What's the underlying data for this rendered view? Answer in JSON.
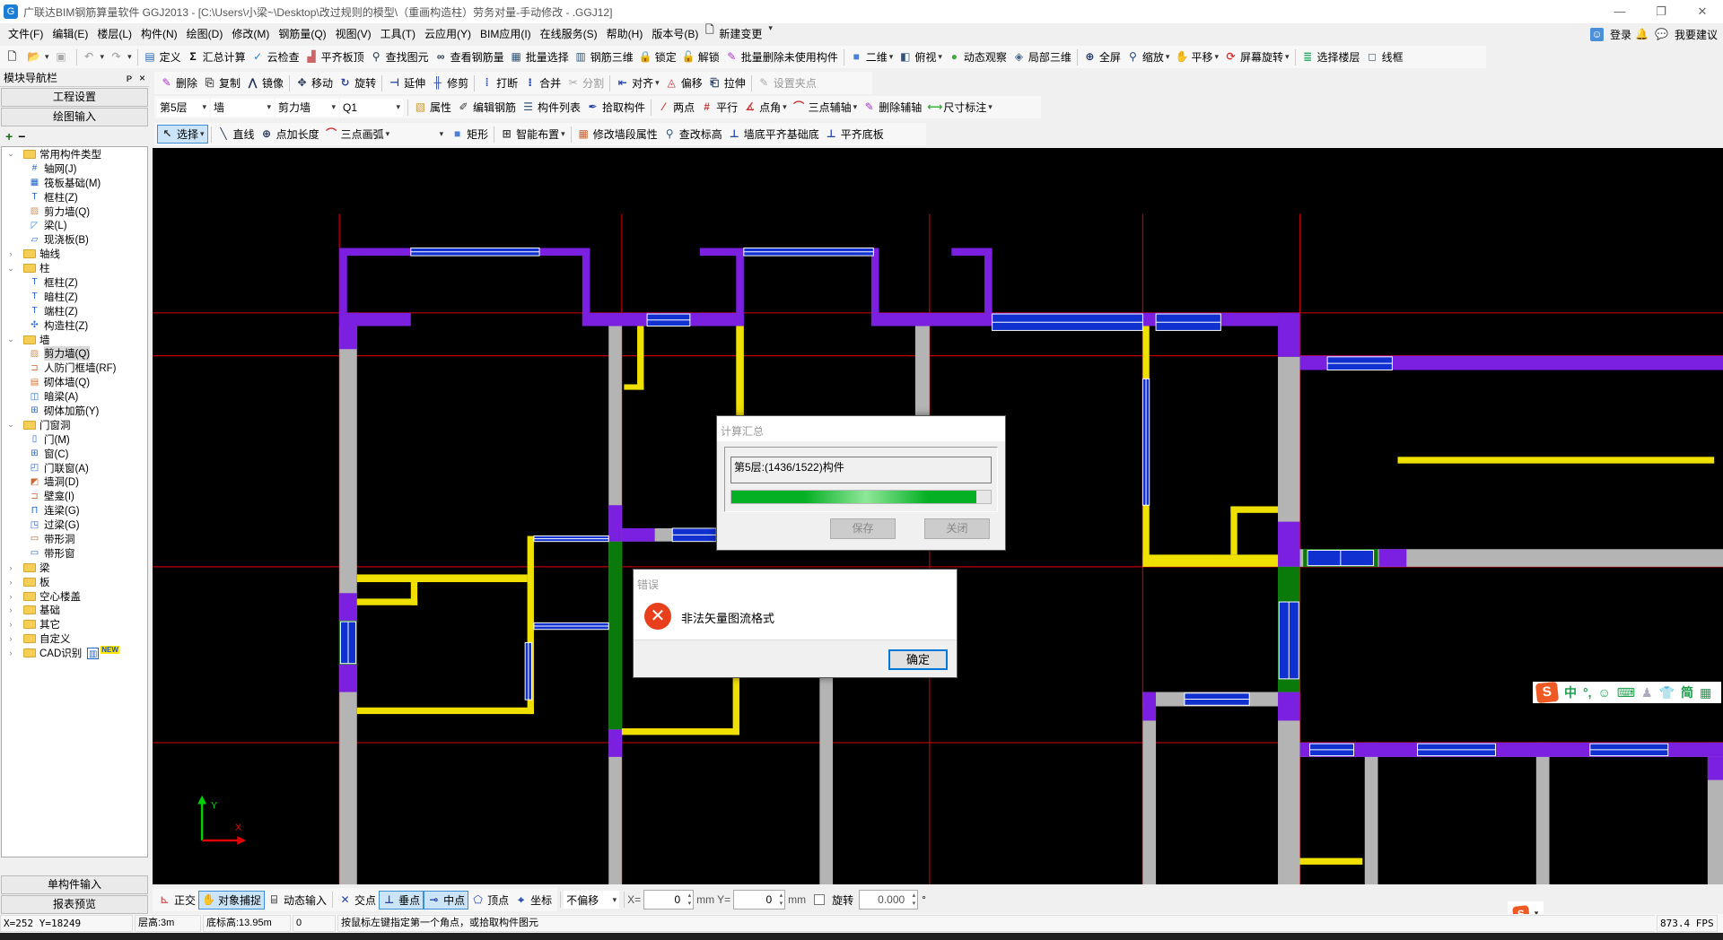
{
  "window": {
    "title": "广联达BIM钢筋算量软件 GGJ2013 - [C:\\Users\\小梁~\\Desktop\\改过规则的模型\\（重画构造柱）劳务对量-手动修改 - .GGJ12]",
    "minimize": "—",
    "restore": "❐",
    "close": "✕"
  },
  "menu": {
    "items": [
      "文件(F)",
      "编辑(E)",
      "楼层(L)",
      "构件(N)",
      "绘图(D)",
      "修改(M)",
      "钢筋量(Q)",
      "视图(V)",
      "工具(T)",
      "云应用(Y)",
      "BIM应用(I)",
      "在线服务(S)",
      "帮助(H)",
      "版本号(B)",
      "新建变更"
    ],
    "login": "登录",
    "suggest": "我要建议"
  },
  "toolbar1": [
    {
      "icon": "new-file",
      "label": ""
    },
    {
      "icon": "open-folder",
      "label": "",
      "dd": true
    },
    {
      "icon": "save",
      "label": "",
      "disabled": true
    },
    {
      "sep": true
    },
    {
      "icon": "undo",
      "label": "",
      "dd": true,
      "disabled": true
    },
    {
      "icon": "redo",
      "label": "",
      "dd": true,
      "disabled": true
    },
    {
      "sep": true
    },
    {
      "icon": "define",
      "label": "定义"
    },
    {
      "icon": "sigma",
      "label": "汇总计算"
    },
    {
      "icon": "cloud-check",
      "label": "云检查"
    },
    {
      "icon": "level-slab",
      "label": "平齐板顶"
    },
    {
      "icon": "binoculars",
      "label": "查找图元"
    },
    {
      "icon": "rebar-view",
      "label": "查看钢筋量"
    },
    {
      "icon": "batch-select",
      "label": "批量选择"
    },
    {
      "icon": "rebar-3d",
      "label": "钢筋三维"
    },
    {
      "icon": "lock",
      "label": "锁定"
    },
    {
      "icon": "unlock",
      "label": "解锁"
    },
    {
      "icon": "brush",
      "label": "批量删除未使用构件"
    },
    {
      "sep": true
    },
    {
      "icon": "2d",
      "label": "二维",
      "dd": true
    },
    {
      "icon": "cube",
      "label": "俯视",
      "dd": true
    },
    {
      "icon": "orbit",
      "label": "动态观察"
    },
    {
      "icon": "local-3d",
      "label": "局部三维"
    },
    {
      "sep": true
    },
    {
      "icon": "fullscreen",
      "label": "全屏"
    },
    {
      "icon": "zoom",
      "label": "缩放",
      "dd": true
    },
    {
      "icon": "pan",
      "label": "平移",
      "dd": true
    },
    {
      "icon": "rotate-screen",
      "label": "屏幕旋转",
      "dd": true
    },
    {
      "sep": true
    },
    {
      "icon": "floors",
      "label": "选择楼层"
    },
    {
      "icon": "wireframe",
      "label": "线框"
    }
  ],
  "toolbar2": [
    {
      "icon": "delete",
      "label": "删除"
    },
    {
      "icon": "copy",
      "label": "复制"
    },
    {
      "icon": "mirror",
      "label": "镜像"
    },
    {
      "sep": true
    },
    {
      "icon": "move",
      "label": "移动"
    },
    {
      "icon": "rotate",
      "label": "旋转"
    },
    {
      "sep": true
    },
    {
      "icon": "extend",
      "label": "延伸"
    },
    {
      "icon": "trim",
      "label": "修剪"
    },
    {
      "sep": true
    },
    {
      "icon": "break",
      "label": "打断"
    },
    {
      "icon": "merge",
      "label": "合并"
    },
    {
      "icon": "split",
      "label": "分割",
      "disabled": true
    },
    {
      "sep": true
    },
    {
      "icon": "align",
      "label": "对齐",
      "dd": true
    },
    {
      "icon": "offset",
      "label": "偏移"
    },
    {
      "icon": "stretch",
      "label": "拉伸"
    },
    {
      "sep": true
    },
    {
      "icon": "grip",
      "label": "设置夹点",
      "disabled": true
    }
  ],
  "toolbar3": {
    "selects": [
      "第5层",
      "墙",
      "剪力墙",
      "Q1"
    ],
    "items": [
      {
        "sep": true
      },
      {
        "icon": "properties",
        "label": "属性"
      },
      {
        "icon": "edit-rebar",
        "label": "编辑钢筋"
      },
      {
        "icon": "list",
        "label": "构件列表"
      },
      {
        "icon": "eyedropper",
        "label": "拾取构件"
      },
      {
        "sep": true
      },
      {
        "icon": "two-point",
        "label": "两点"
      },
      {
        "icon": "parallel",
        "label": "平行"
      },
      {
        "icon": "point-angle",
        "label": "点角",
        "dd": true
      },
      {
        "icon": "three-point-axis",
        "label": "三点辅轴",
        "dd": true
      },
      {
        "icon": "delete-axis",
        "label": "删除辅轴"
      },
      {
        "icon": "dimension",
        "label": "尺寸标注",
        "dd": true
      }
    ]
  },
  "toolbar4": [
    {
      "icon": "cursor",
      "label": "选择",
      "dd": true,
      "active": true
    },
    {
      "sep": true
    },
    {
      "icon": "line",
      "label": "直线"
    },
    {
      "icon": "point-length",
      "label": "点加长度"
    },
    {
      "icon": "arc",
      "label": "三点画弧",
      "dd": true
    },
    {
      "blankselect": true
    },
    {
      "icon": "rectangle",
      "label": "矩形"
    },
    {
      "sep": true
    },
    {
      "icon": "smart-layout",
      "label": "智能布置",
      "dd": true
    },
    {
      "sep": true
    },
    {
      "icon": "wall-props",
      "label": "修改墙段属性"
    },
    {
      "icon": "elevation",
      "label": "查改标高"
    },
    {
      "icon": "wall-base",
      "label": "墙底平齐基础底"
    },
    {
      "icon": "slab-base",
      "label": "平齐底板"
    }
  ],
  "nav": {
    "title": "模块导航栏",
    "pin": "ᴘ",
    "close": "×",
    "project_settings": "工程设置",
    "drawing_input": "绘图输入",
    "expand_all": "+",
    "collapse_all": "−",
    "single_input": "单构件输入",
    "report_preview": "报表预览",
    "tree": [
      {
        "level": 0,
        "label": "常用构件类型",
        "expanded": true
      },
      {
        "level": 1,
        "label": "轴网(J)",
        "icon": "grid"
      },
      {
        "level": 1,
        "label": "筏板基础(M)",
        "icon": "raft"
      },
      {
        "level": 1,
        "label": "框柱(Z)",
        "icon": "column"
      },
      {
        "level": 1,
        "label": "剪力墙(Q)",
        "icon": "shear-wall"
      },
      {
        "level": 1,
        "label": "梁(L)",
        "icon": "beam"
      },
      {
        "level": 1,
        "label": "现浇板(B)",
        "icon": "slab"
      },
      {
        "level": 0,
        "label": "轴线",
        "expanded": false
      },
      {
        "level": 0,
        "label": "柱",
        "expanded": true
      },
      {
        "level": 1,
        "label": "框柱(Z)",
        "icon": "column"
      },
      {
        "level": 1,
        "label": "暗柱(Z)",
        "icon": "column"
      },
      {
        "level": 1,
        "label": "端柱(Z)",
        "icon": "column"
      },
      {
        "level": 1,
        "label": "构造柱(Z)",
        "icon": "constructional-column"
      },
      {
        "level": 0,
        "label": "墙",
        "expanded": true
      },
      {
        "level": 1,
        "label": "剪力墙(Q)",
        "icon": "shear-wall",
        "selected": true
      },
      {
        "level": 1,
        "label": "人防门框墙(RF)",
        "icon": "door-frame-wall"
      },
      {
        "level": 1,
        "label": "砌体墙(Q)",
        "icon": "masonry-wall"
      },
      {
        "level": 1,
        "label": "暗梁(A)",
        "icon": "hidden-beam"
      },
      {
        "level": 1,
        "label": "砌体加筋(Y)",
        "icon": "masonry-rebar"
      },
      {
        "level": 0,
        "label": "门窗洞",
        "expanded": true
      },
      {
        "level": 1,
        "label": "门(M)",
        "icon": "door"
      },
      {
        "level": 1,
        "label": "窗(C)",
        "icon": "window"
      },
      {
        "level": 1,
        "label": "门联窗(A)",
        "icon": "door-window"
      },
      {
        "level": 1,
        "label": "墙洞(D)",
        "icon": "wall-hole"
      },
      {
        "level": 1,
        "label": "壁龛(I)",
        "icon": "niche"
      },
      {
        "level": 1,
        "label": "连梁(G)",
        "icon": "coupling-beam"
      },
      {
        "level": 1,
        "label": "过梁(G)",
        "icon": "lintel"
      },
      {
        "level": 1,
        "label": "带形洞",
        "icon": "strip-hole"
      },
      {
        "level": 1,
        "label": "带形窗",
        "icon": "strip-window"
      },
      {
        "level": 0,
        "label": "梁",
        "expanded": false
      },
      {
        "level": 0,
        "label": "板",
        "expanded": false
      },
      {
        "level": 0,
        "label": "空心楼盖",
        "expanded": false
      },
      {
        "level": 0,
        "label": "基础",
        "expanded": false
      },
      {
        "level": 0,
        "label": "其它",
        "expanded": false
      },
      {
        "level": 0,
        "label": "自定义",
        "expanded": false
      },
      {
        "level": 0,
        "label": "CAD识别",
        "expanded": false,
        "badge": "NEW"
      }
    ]
  },
  "canvas": {
    "axis_y": "Y",
    "axis_x": "X"
  },
  "calc_dialog": {
    "title": "计算汇总",
    "status": "第5层:(1436/1522)构件",
    "progress": 0.943,
    "save": "保存",
    "close": "关闭"
  },
  "error_dialog": {
    "title": "错误",
    "message": "非法矢量图流格式",
    "ok": "确定"
  },
  "ime": {
    "mode": "中",
    "punct": "°,",
    "simplified": "简"
  },
  "bottombar": {
    "items": [
      {
        "icon": "ortho",
        "label": "正交"
      },
      {
        "icon": "snap",
        "label": "对象捕捉",
        "active": true
      },
      {
        "icon": "dynamic-input",
        "label": "动态输入"
      },
      {
        "sep": true
      },
      {
        "icon": "intersection",
        "label": "交点"
      },
      {
        "icon": "perpendicular",
        "label": "垂点",
        "active": true
      },
      {
        "icon": "midpoint",
        "label": "中点",
        "active": true
      },
      {
        "icon": "vertex",
        "label": "顶点"
      },
      {
        "icon": "coordinate",
        "label": "坐标"
      }
    ],
    "offset_select": "不偏移",
    "x_label": "X=",
    "x_value": "0",
    "x_unit": "mm",
    "y_label": "Y=",
    "y_value": "0",
    "y_unit": "mm",
    "rotate_checked": false,
    "rotate_label": "旋转",
    "rotate_value": "0.000",
    "degree": "°"
  },
  "status": {
    "coords": "X=252 Y=18249",
    "floor_height": "层高:3m",
    "base_elevation": "底标高:13.95m",
    "value": "0",
    "hint": "按鼠标左键指定第一个角点，或拾取构件图元",
    "fps": "873.4 FPS"
  },
  "colors": {
    "shear_wall": "#7b1fe0",
    "masonry_wall": "#b4b4b4",
    "beam": "#f0e000",
    "coupling_beam": "#0a7a0a",
    "axis": "#c00000",
    "progress": "#06b025"
  }
}
